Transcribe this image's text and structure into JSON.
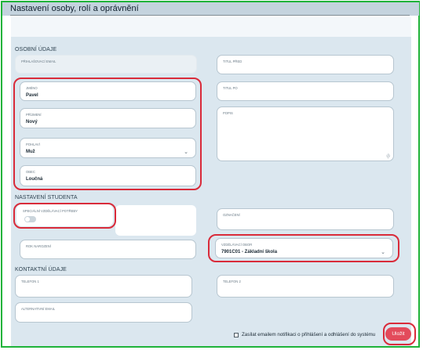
{
  "header": {
    "title": "Nastavení osoby, rolí a oprávnění"
  },
  "sections": {
    "personal": "OSOBNÍ ÚDAJE",
    "student": "NASTAVENÍ STUDENTA",
    "contact": "KONTAKTNÍ ÚDAJE"
  },
  "fields": {
    "login_email": {
      "label": "PŘIHLAŠOVACÍ EMAIL",
      "value": ""
    },
    "titul_pred": {
      "label": "TITUL PŘED",
      "value": ""
    },
    "jmeno": {
      "label": "JMÉNO",
      "value": "Pavel"
    },
    "titul_po": {
      "label": "TITUL PO",
      "value": ""
    },
    "prijmeni": {
      "label": "PŘÍJMENÍ",
      "value": "Nový"
    },
    "popis": {
      "label": "POPIS",
      "value": ""
    },
    "pohlavi": {
      "label": "POHLAVÍ",
      "value": "Muž"
    },
    "obec": {
      "label": "OBEC",
      "value": "Loučná"
    },
    "specialni": {
      "label": "SPECIÁLNÍ VZDĚLÁVACÍ POTŘEBY",
      "value": false
    },
    "oznaceni": {
      "label": "OZNAČENÍ",
      "value": ""
    },
    "rok_narozeni": {
      "label": "ROK NAROZENÍ",
      "value": ""
    },
    "vzdelavaci_obor": {
      "label": "VZDĚLÁVACÍ OBOR",
      "value": "7901C01 - Základní škola"
    },
    "telefon1": {
      "label": "TELEFON 1",
      "value": ""
    },
    "telefon2": {
      "label": "TELEFON 2",
      "value": ""
    },
    "alt_email": {
      "label": "ALTERNATIVNÍ EMAIL",
      "value": ""
    }
  },
  "notify": {
    "label": "Zasílat emailem notifikaci o přihlášení a odhlášení do systému",
    "checked": false
  },
  "actions": {
    "save": "Uložit"
  },
  "colors": {
    "highlight": "#d92b3a",
    "frame": "#1fb339",
    "button": "#e34b5b"
  },
  "icons": {
    "select": "chevron-down-icon",
    "textarea": "resize-handle-icon"
  }
}
